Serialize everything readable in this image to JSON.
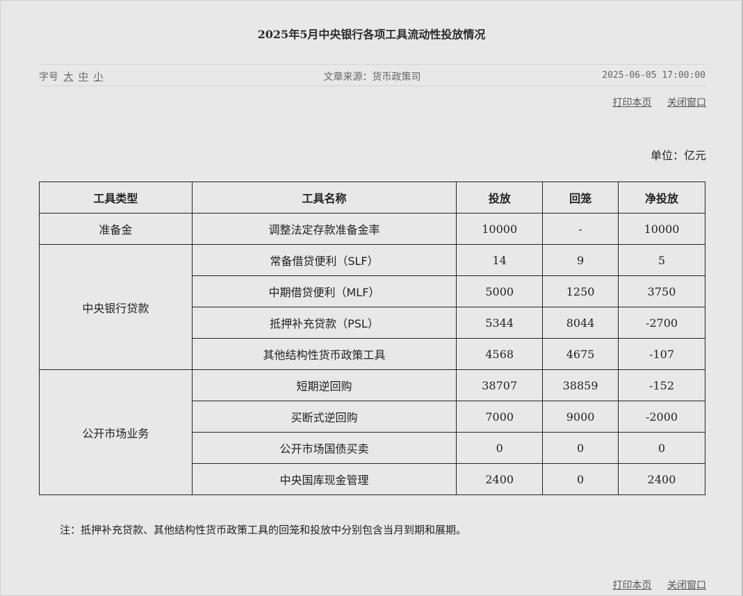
{
  "title": "2025年5月中央银行各项工具流动性投放情况",
  "meta": {
    "font_label": "字号",
    "font_sizes": [
      "大",
      "中",
      "小"
    ],
    "source": "文章来源：货币政策司",
    "date": "2025-06-05 17:00:00"
  },
  "links": {
    "print": "打印本页",
    "close": "关闭窗口"
  },
  "unit": "单位：亿元",
  "table": {
    "headers": [
      "工具类型",
      "工具名称",
      "投放",
      "回笼",
      "净投放"
    ],
    "groups": [
      {
        "category": "准备金",
        "rows": [
          {
            "name": "调整法定存款准备金率",
            "release": "10000",
            "withdraw": "-",
            "net": "10000"
          }
        ]
      },
      {
        "category": "中央银行贷款",
        "rows": [
          {
            "name": "常备借贷便利（SLF）",
            "release": "14",
            "withdraw": "9",
            "net": "5"
          },
          {
            "name": "中期借贷便利（MLF）",
            "release": "5000",
            "withdraw": "1250",
            "net": "3750"
          },
          {
            "name": "抵押补充贷款（PSL）",
            "release": "5344",
            "withdraw": "8044",
            "net": "-2700"
          },
          {
            "name": "其他结构性货币政策工具",
            "release": "4568",
            "withdraw": "4675",
            "net": "-107"
          }
        ]
      },
      {
        "category": "公开市场业务",
        "rows": [
          {
            "name": "短期逆回购",
            "release": "38707",
            "withdraw": "38859",
            "net": "-152"
          },
          {
            "name": "买断式逆回购",
            "release": "7000",
            "withdraw": "9000",
            "net": "-2000"
          },
          {
            "name": "公开市场国债买卖",
            "release": "0",
            "withdraw": "0",
            "net": "0"
          },
          {
            "name": "中央国库现金管理",
            "release": "2400",
            "withdraw": "0",
            "net": "2400"
          }
        ]
      }
    ]
  },
  "note": "注：抵押补充贷款、其他结构性货币政策工具的回笼和投放中分别包含当月到期和展期。"
}
